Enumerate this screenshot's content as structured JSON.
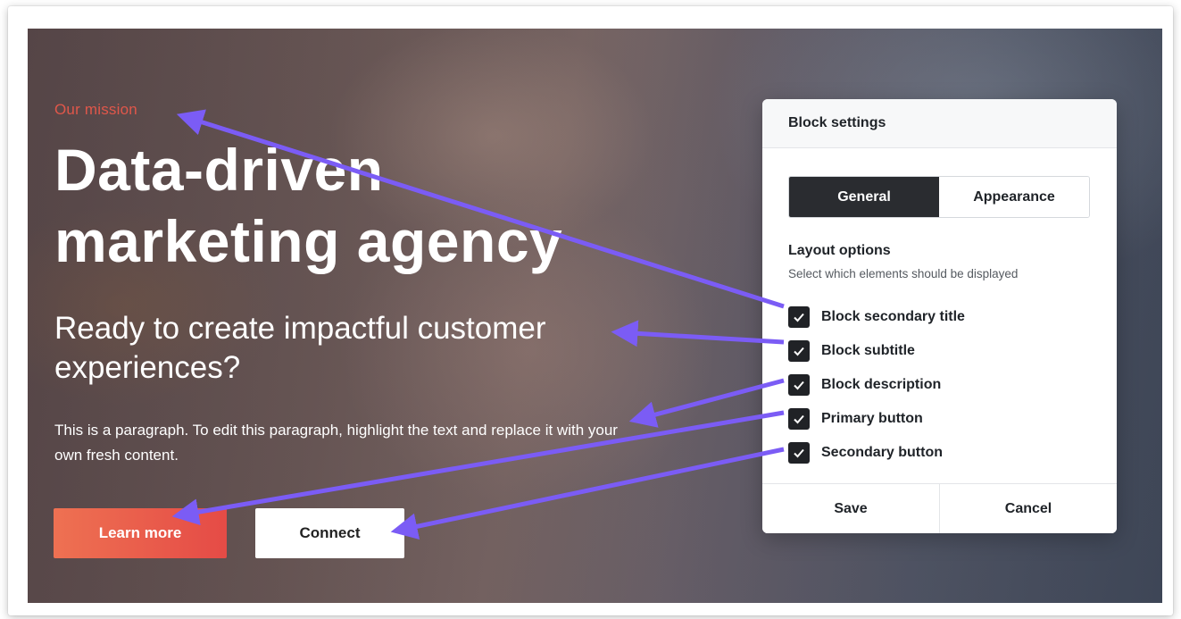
{
  "hero": {
    "secondary_title": "Our mission",
    "title": "Data-driven marketing agency",
    "subtitle": "Ready to create impactful customer experiences?",
    "description": "This is a paragraph. To edit this paragraph, highlight the text and replace it with your own fresh content.",
    "primary_button": "Learn more",
    "secondary_button": "Connect"
  },
  "panel": {
    "title": "Block settings",
    "tabs": [
      {
        "label": "General",
        "active": true
      },
      {
        "label": "Appearance",
        "active": false
      }
    ],
    "layout_title": "Layout options",
    "layout_description": "Select which elements should be displayed",
    "options": [
      {
        "label": "Block secondary title",
        "checked": true
      },
      {
        "label": "Block subtitle",
        "checked": true
      },
      {
        "label": "Block description",
        "checked": true
      },
      {
        "label": "Primary button",
        "checked": true
      },
      {
        "label": "Secondary button",
        "checked": true
      }
    ],
    "save_label": "Save",
    "cancel_label": "Cancel"
  },
  "colors": {
    "accent": "#e0574a",
    "arrow": "#7b5cf5",
    "tab_active": "#2a2c30"
  }
}
